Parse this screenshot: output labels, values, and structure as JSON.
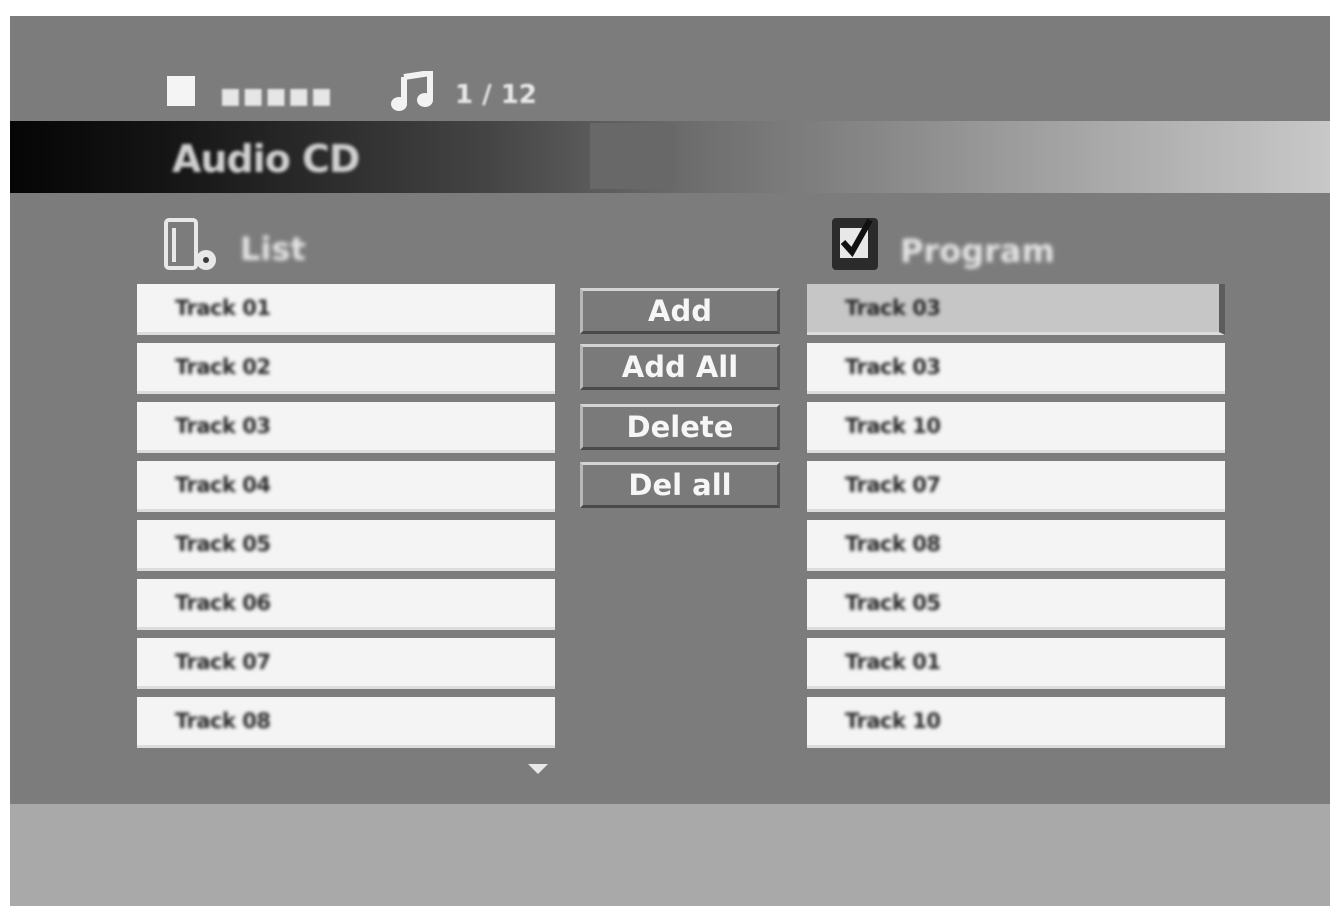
{
  "status": {
    "time_display": "■■■■■",
    "track_counter": "1 / 12"
  },
  "disc": {
    "type_label": "Audio CD"
  },
  "list": {
    "header": "List",
    "items": [
      {
        "label": "Track 01"
      },
      {
        "label": "Track 02"
      },
      {
        "label": "Track 03"
      },
      {
        "label": "Track 04"
      },
      {
        "label": "Track 05"
      },
      {
        "label": "Track 06"
      },
      {
        "label": "Track 07"
      },
      {
        "label": "Track 08"
      }
    ]
  },
  "buttons": {
    "add": "Add",
    "add_all": "Add All",
    "delete": "Delete",
    "del_all": "Del all"
  },
  "program": {
    "header": "Program",
    "items": [
      {
        "label": "Track 03"
      },
      {
        "label": "Track 03"
      },
      {
        "label": "Track 10"
      },
      {
        "label": "Track 07"
      },
      {
        "label": "Track 08"
      },
      {
        "label": "Track 05"
      },
      {
        "label": "Track 01"
      },
      {
        "label": "Track 10"
      }
    ]
  }
}
